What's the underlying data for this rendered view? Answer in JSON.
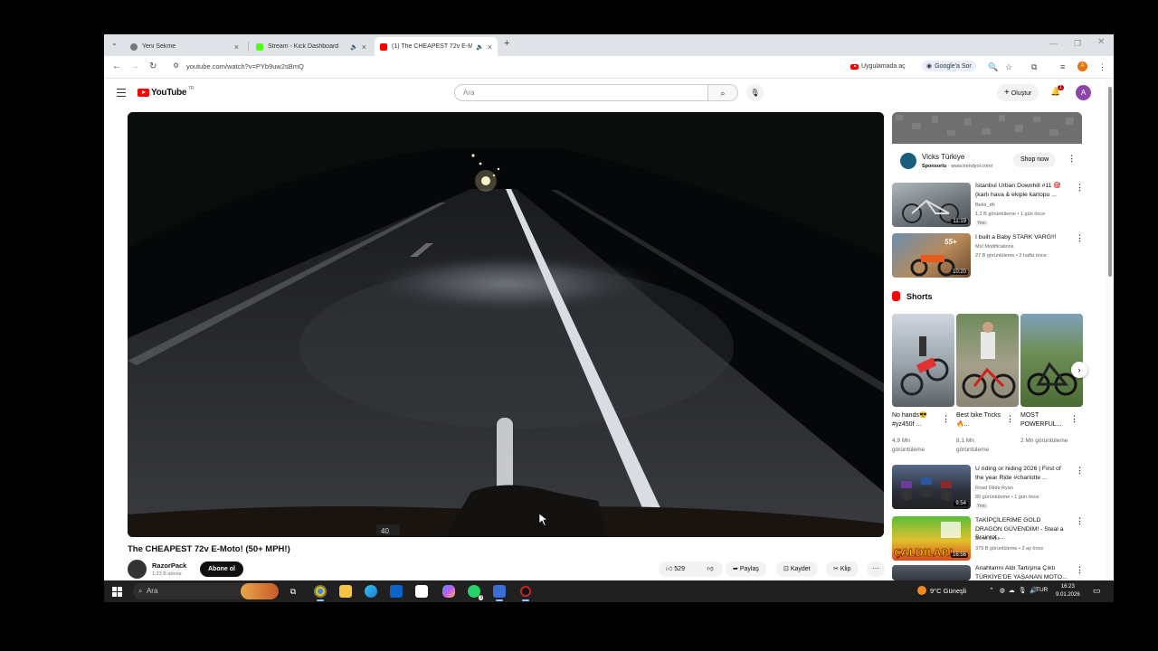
{
  "browser": {
    "tabs": [
      {
        "title": "Yeni Sekme",
        "favicon_color": "#5f6368",
        "active": false,
        "audio": false
      },
      {
        "title": "Stream - Kick Dashboard",
        "favicon_color": "#53fc18",
        "active": false,
        "audio": true
      },
      {
        "title": "(1) The CHEAPEST 72v E-M...",
        "favicon_color": "#ff0000",
        "active": true,
        "audio": true
      }
    ],
    "new_tab_symbol": "+",
    "url": "youtube.com/watch?v=PYb9uw2sBmQ",
    "open_in_app_label": "Uygulamada aç",
    "google_lens_label": "Google'a Sor",
    "profile_initial": "A"
  },
  "youtube": {
    "logo_text": "YouTube",
    "country_code": "TR",
    "search_placeholder": "Ara",
    "create_label": "Oluştur",
    "notification_count": "1",
    "avatar_initial": "A"
  },
  "video": {
    "title": "The CHEAPEST 72v E-Moto! (50+ MPH!)",
    "channel_name": "RazorPack",
    "subscribers": "1,23 B abone",
    "subscribe_label": "Abone ol",
    "likes": "529",
    "share_label": "Paylaş",
    "save_label": "Kaydet",
    "clip_label": "Klip",
    "overlay_speed_text": "40"
  },
  "ad": {
    "advertiser": "Vicks Türkiye",
    "sponsored_label": "Sponsorlu",
    "domain": "www.trendyol.com/",
    "cta": "Shop now"
  },
  "recommendations_top": [
    {
      "title": "İstanbul Urban Downhill #11 🎯 (karlı hava & ekiple kartopu ...",
      "channel": "Bekir_dh",
      "meta": "1,2 B görüntüleme • 1 gün önce",
      "badge": "Yeni",
      "duration": "11:19"
    },
    {
      "title": "I built a Baby STARK VARG!!!",
      "channel": "MxI Modifications",
      "meta": "27 B görüntüleme • 2 hafta önce",
      "badge": "",
      "duration": "10:20"
    }
  ],
  "shorts": {
    "heading": "Shorts",
    "items": [
      {
        "title": "No hands😎 #yz450f ...",
        "views": "4,9 Mn görüntüleme"
      },
      {
        "title": "Best bike Tricks 🔥...",
        "views": "8,1 Mn görüntüleme"
      },
      {
        "title": "MOST POWERFUL...",
        "views": "2 Mn görüntüleme"
      }
    ]
  },
  "recommendations_bottom": [
    {
      "title": "U riding or hiding 2026 | First of the year Ride #charlotte ...",
      "channel": "Road Glide Ryan",
      "meta": "89 görüntüleme • 1 gün önce",
      "badge": "Yeni",
      "duration": "9:54"
    },
    {
      "title": "TAKİPÇİLERİME GOLD DRAGON GÜVENDİM! - Steal a Brainrot ...",
      "channel": "Berat Beyz",
      "meta": "379 B görüntüleme • 2 ay önce",
      "badge": "",
      "duration": "16:56"
    },
    {
      "title": "Anahtarını Aldı Tartışma Çıktı TÜRKİYE'DE YAŞANAN MOTO...",
      "channel": "",
      "meta": "",
      "badge": "",
      "duration": ""
    }
  ],
  "taskbar": {
    "search_placeholder": "Ara",
    "weather": "9°C  Güneşli",
    "language": "TUR",
    "time": "16:23",
    "date": "9.01.2026",
    "whatsapp_badge": "3"
  }
}
